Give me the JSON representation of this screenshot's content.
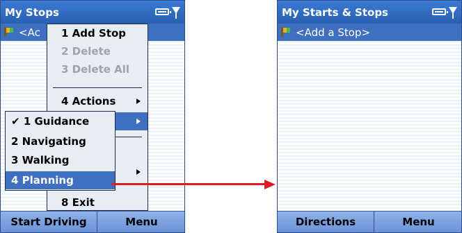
{
  "left_screen": {
    "title": "My Stops",
    "add_stop_label": "<Ac",
    "softkeys": {
      "left": "Start Driving",
      "right": "Menu"
    },
    "menu": {
      "items": [
        {
          "label": "1 Add Stop",
          "disabled": false
        },
        {
          "label": "2 Delete",
          "disabled": true
        },
        {
          "label": "3 Delete All",
          "disabled": true
        },
        {
          "label": "4 Actions",
          "submenu": true
        },
        {
          "label": "",
          "submenu": true,
          "highlighted": true
        },
        {
          "label": "8 Exit"
        }
      ]
    },
    "submenu": {
      "items": [
        {
          "label": "1 Guidance",
          "checked": true
        },
        {
          "label": "2 Navigating"
        },
        {
          "label": "3 Walking"
        },
        {
          "label": "4 Planning",
          "highlighted": true
        }
      ]
    }
  },
  "right_screen": {
    "title": "My Starts & Stops",
    "add_stop_label": "<Add a Stop>",
    "softkeys": {
      "left": "Directions",
      "right": "Menu"
    }
  },
  "colors": {
    "titlebar": "#2a5faf",
    "highlight": "#3e6fc1",
    "arrow": "#e01b24"
  },
  "icons": [
    "battery-icon",
    "signal-icon",
    "flag-icon",
    "submenu-arrow-icon",
    "checkmark-icon"
  ]
}
